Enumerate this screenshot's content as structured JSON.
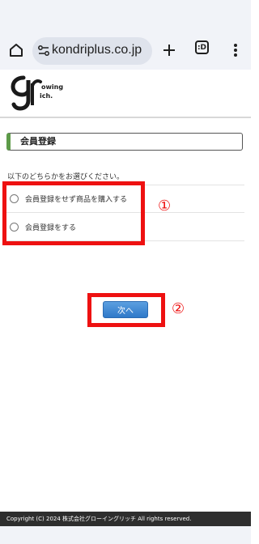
{
  "browser": {
    "url": "kondriplus.co.jp",
    "tab_count": ":D"
  },
  "logo": {
    "line1": "owing",
    "line2": "ich."
  },
  "page": {
    "section_title": "会員登録",
    "instruction": "以下のどちらかをお選びください。",
    "options": [
      {
        "label": "会員登録をせず商品を購入する"
      },
      {
        "label": "会員登録をする"
      }
    ],
    "next_button_label": "次へ"
  },
  "annotations": {
    "marker1": "①",
    "marker2": "②"
  },
  "footer": {
    "copyright": "Copyright (C) 2024 株式会社グローイングリッチ All rights reserved."
  },
  "colors": {
    "accent_green": "#5d9b48",
    "highlight_red": "#ee1111",
    "button_blue": "#3a84d3"
  }
}
